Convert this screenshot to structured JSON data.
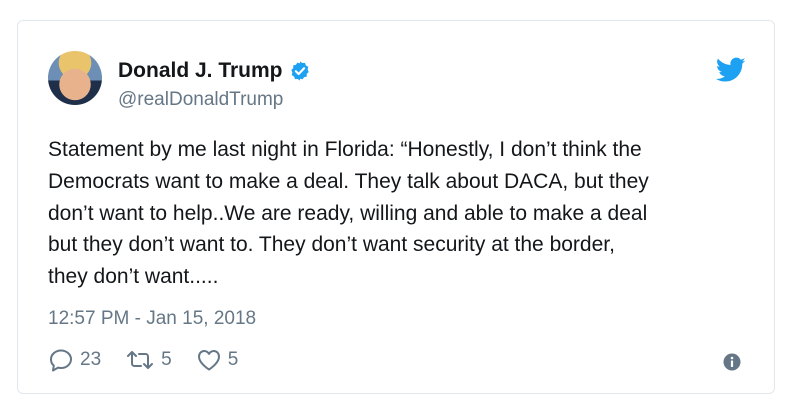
{
  "tweet": {
    "author_name": "Donald J. Trump",
    "author_handle": "@realDonaldTrump",
    "text_lines": [
      "Statement by me last night in Florida: “Honestly, I don’t think the",
      "Democrats want to make a deal. They talk about DACA, but they",
      "don’t want to help..We are ready, willing and able to make a deal",
      "but they don’t want to. They don’t want security at the border,",
      "they don’t want....."
    ],
    "timestamp": "12:57 PM - Jan 15, 2018",
    "reply_count": "23",
    "retweet_count": "5",
    "like_count": "5"
  },
  "colors": {
    "accent": "#1da1f2",
    "secondary_text": "#657786",
    "border": "#e1e8ed"
  },
  "icons": {
    "verified": "verified-badge-icon",
    "brand": "twitter-bird-icon",
    "reply": "reply-icon",
    "retweet": "retweet-icon",
    "like": "heart-icon",
    "info": "info-icon"
  }
}
